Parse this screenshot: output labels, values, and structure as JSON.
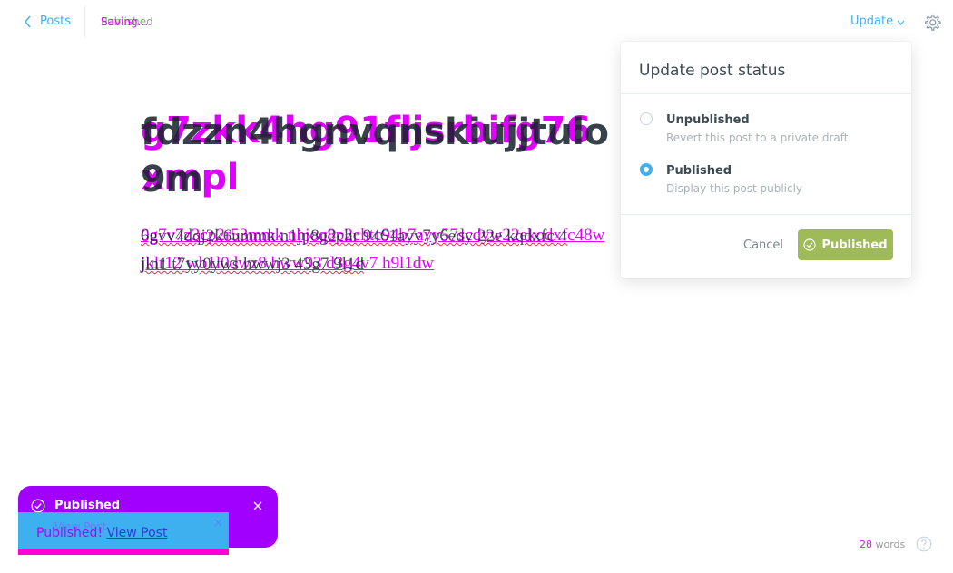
{
  "topbar": {
    "back_label": "Posts",
    "status_text_a": "Published",
    "status_text_b": "Saving...",
    "update_label": "Update"
  },
  "editor": {
    "title_lines_overlay": [
      "g7zkk4hg91fljsrbifg76",
      "xmpl"
    ],
    "title_lines_base": [
      "fdzzn4hgnvqnskiujjtulo",
      "9m"
    ],
    "body_lines_overlay": [
      "0g7v7z3cp2r53mmk    nhjoq8p2chtc94b7ayy57scdyw22ekodxfc48w",
      "jklr12 wb1l0dwz8 hww93 d3g4v7 h9l1dw"
    ],
    "body_lines_base": [
      "6gvv4dqj2k6ummk    n1jp8g2chr 9461ayy7y6edy 22e kqdxfc 4",
      "jln1 t7yy0yws hwwj3 43g7 9l1d"
    ]
  },
  "status_popover": {
    "title": "Update post status",
    "options": [
      {
        "label": "Unpublished",
        "description": "Revert this post to a private draft",
        "selected": false
      },
      {
        "label": "Published",
        "description": "Display this post publicly",
        "selected": true
      }
    ],
    "cancel_label": "Cancel",
    "confirm_label": "Published"
  },
  "notifications": {
    "purple_title": "Published",
    "ghost_text": "View Post",
    "message_prefix": "Published!",
    "view_post_label": "View Post"
  },
  "footer": {
    "word_count_base": "20",
    "word_count_overlay": "28",
    "word_label": "words"
  },
  "colors": {
    "accent_blue": "#3eb0ef",
    "publish_green": "#9fbb58",
    "purple_toast": "#a100ff",
    "magenta": "#e100ff"
  }
}
